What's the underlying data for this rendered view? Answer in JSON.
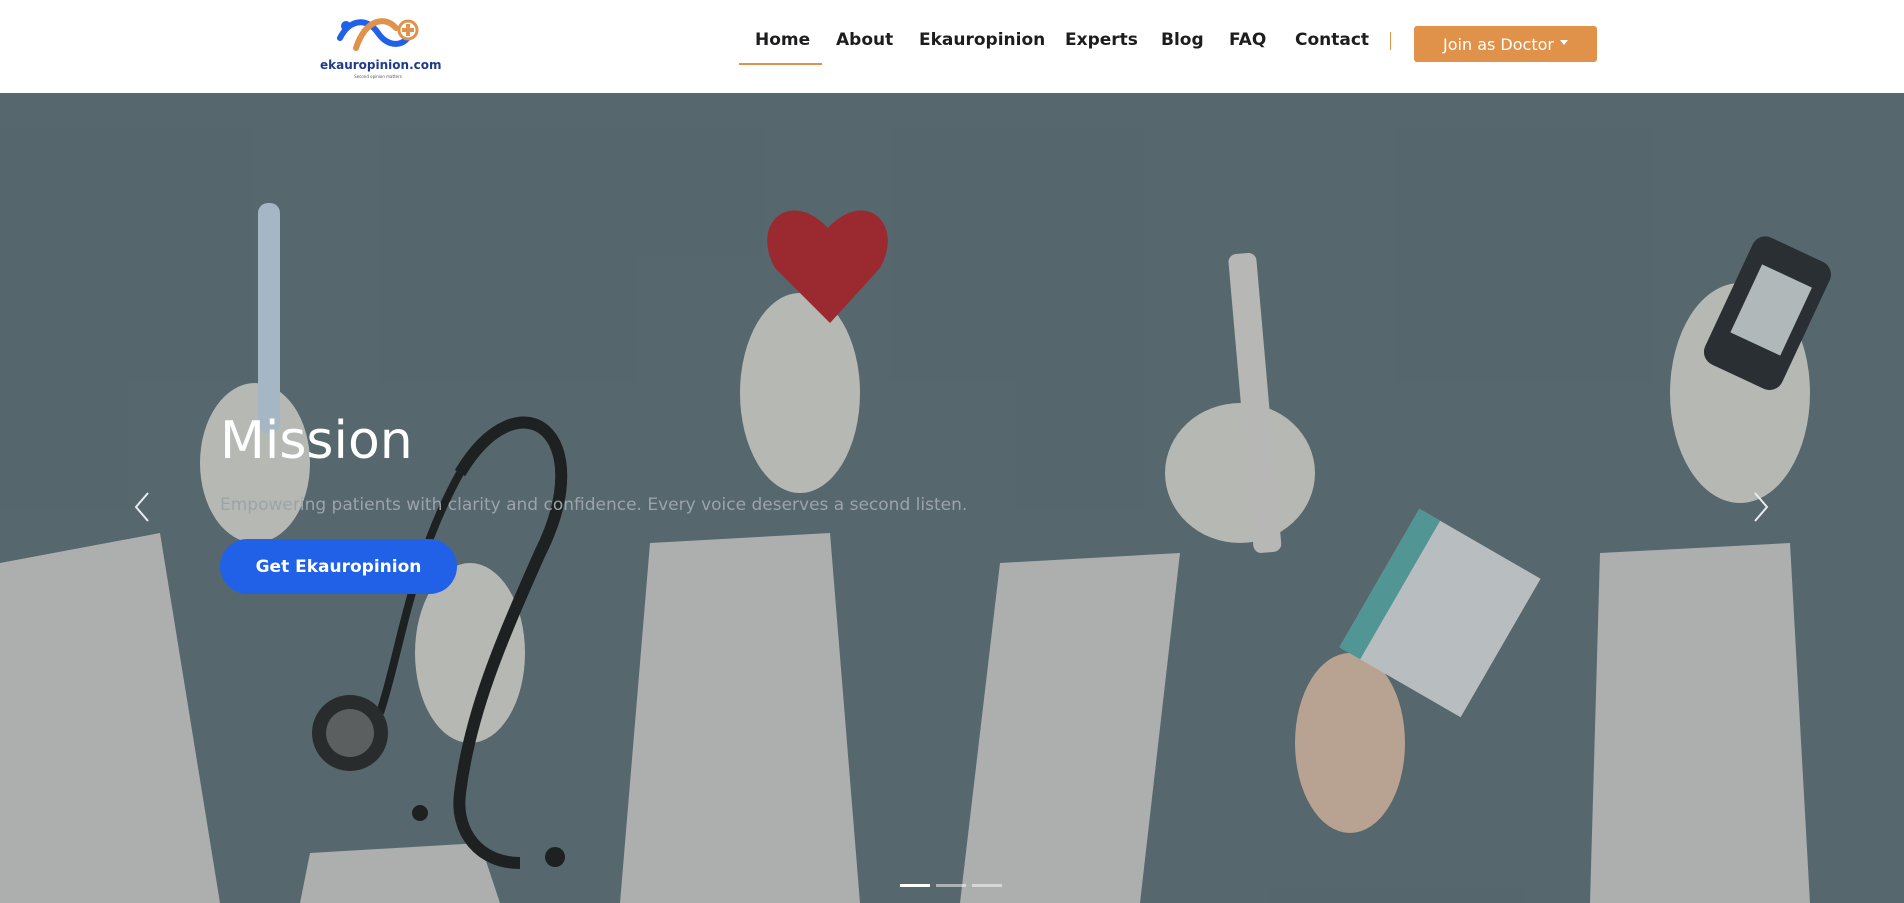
{
  "header": {
    "logo": {
      "text": "ekauropinion.com",
      "tagline": "Second opinion matters"
    },
    "nav": [
      {
        "label": "Home",
        "active": true
      },
      {
        "label": "About"
      },
      {
        "label": "Ekauropinion"
      },
      {
        "label": "Experts"
      },
      {
        "label": "Blog"
      },
      {
        "label": "FAQ"
      },
      {
        "label": "Contact"
      }
    ],
    "join_label": "Join as Doctor"
  },
  "hero": {
    "title": "Mission",
    "subtitle": "Empowering patients with clarity and confidence. Every voice deserves a second listen.",
    "cta_label": "Get Ekauropinion",
    "slide_count": 3,
    "active_slide": 1
  },
  "colors": {
    "accent": "#e0914a",
    "cta": "#2161e8",
    "brand": "#1f3c8a",
    "hero_bg": "#5c6d74"
  },
  "icons": {
    "prev": "chevron-left-icon",
    "next": "chevron-right-icon"
  }
}
